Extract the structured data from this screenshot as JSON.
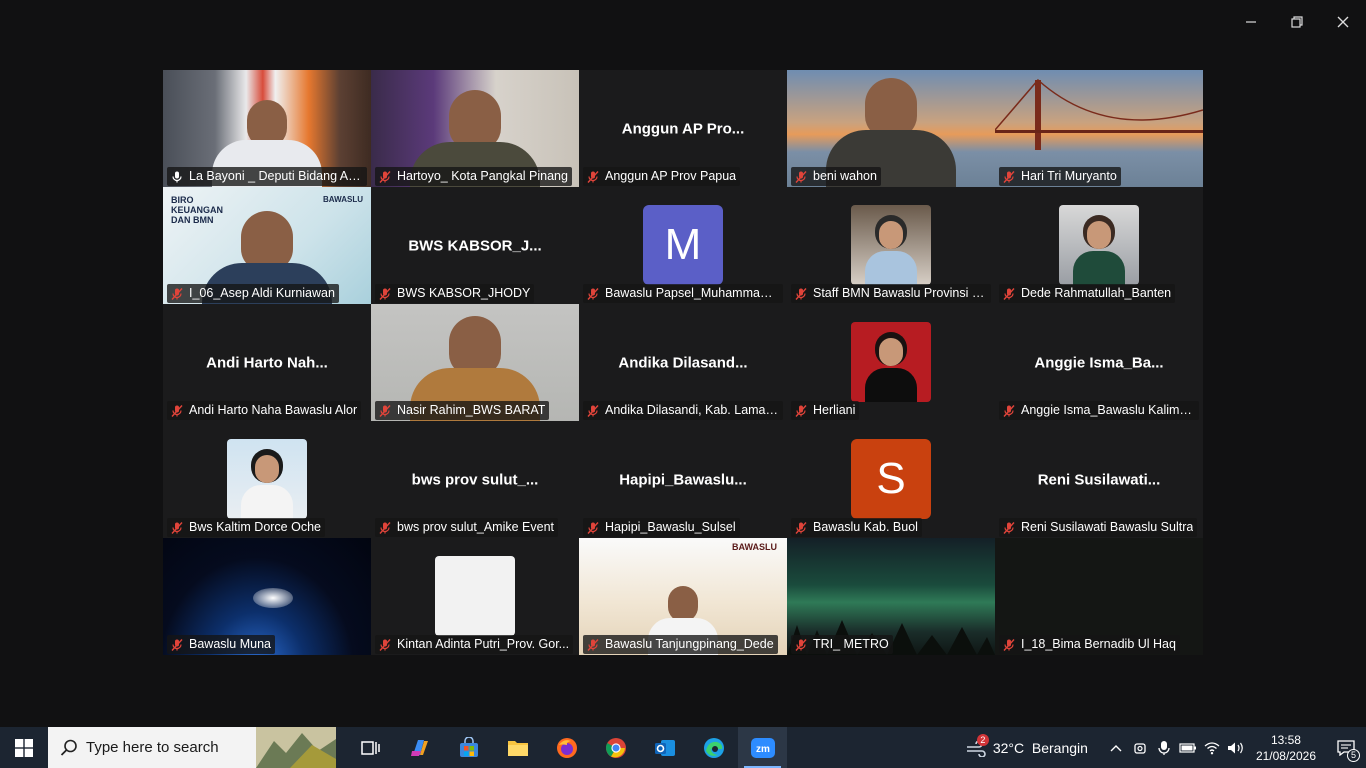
{
  "window_controls": {
    "minimize": "minimize",
    "restore": "restore",
    "close": "close"
  },
  "colors": {
    "active_speaker_border": "#2fd36a",
    "muted_mic": "#e0443a",
    "avatar_m": "#5b5fc7",
    "avatar_s": "#c9410f"
  },
  "participants": [
    {
      "label": "La Bayoni _ Deputi Bidang Ad...",
      "tile_name": "",
      "type": "video",
      "muted": false,
      "active": true
    },
    {
      "label": "Hartoyo_ Kota Pangkal Pinang",
      "tile_name": "",
      "type": "video",
      "muted": true
    },
    {
      "label": "Anggun AP Prov Papua",
      "tile_name": "Anggun AP Pro...",
      "type": "name",
      "muted": true
    },
    {
      "label": "beni wahon",
      "tile_name": "",
      "type": "video",
      "muted": true
    },
    {
      "label": "Hari Tri Muryanto",
      "tile_name": "",
      "type": "video",
      "muted": true
    },
    {
      "label": "I_06_Asep Aldi Kurniawan",
      "tile_name": "",
      "type": "video",
      "muted": true
    },
    {
      "label": "BWS KABSOR_JHODY",
      "tile_name": "BWS KABSOR_J...",
      "type": "name",
      "muted": true
    },
    {
      "label": "Bawaslu Papsel_Muhammad S...",
      "tile_name": "",
      "type": "avatar",
      "initial": "M",
      "muted": true
    },
    {
      "label": "Staff BMN Bawaslu Provinsi P...",
      "tile_name": "",
      "type": "photo",
      "muted": true
    },
    {
      "label": "Dede Rahmatullah_Banten",
      "tile_name": "",
      "type": "photo",
      "muted": true
    },
    {
      "label": "Andi Harto Naha Bawaslu Alor",
      "tile_name": "Andi Harto Nah...",
      "type": "name",
      "muted": true
    },
    {
      "label": "Nasir Rahim_BWS BARAT",
      "tile_name": "",
      "type": "video",
      "muted": true
    },
    {
      "label": "Andika Dilasandi, Kab. Laman...",
      "tile_name": "Andika Dilasand...",
      "type": "name",
      "muted": true
    },
    {
      "label": "Herliani",
      "tile_name": "",
      "type": "photo",
      "muted": true
    },
    {
      "label": "Anggie Isma_Bawaslu Kaliman...",
      "tile_name": "Anggie Isma_Ba...",
      "type": "name",
      "muted": true
    },
    {
      "label": "Bws Kaltim Dorce Oche",
      "tile_name": "",
      "type": "photo",
      "muted": true
    },
    {
      "label": "bws prov sulut_Amike Event",
      "tile_name": "bws prov sulut_...",
      "type": "name",
      "muted": true
    },
    {
      "label": "Hapipi_Bawaslu_Sulsel",
      "tile_name": "Hapipi_Bawaslu...",
      "type": "name",
      "muted": true
    },
    {
      "label": "Bawaslu Kab. Buol",
      "tile_name": "",
      "type": "avatar",
      "initial": "S",
      "muted": true
    },
    {
      "label": "Reni Susilawati Bawaslu Sultra",
      "tile_name": "Reni Susilawati...",
      "type": "name",
      "muted": true
    },
    {
      "label": "Bawaslu Muna",
      "tile_name": "",
      "type": "video",
      "muted": true
    },
    {
      "label": "Kintan Adinta Putri_Prov. Gor...",
      "tile_name": "",
      "type": "photo",
      "muted": true
    },
    {
      "label": "Bawaslu Tanjungpinang_Dede",
      "tile_name": "",
      "type": "video",
      "muted": true
    },
    {
      "label": "TRI_ METRO",
      "tile_name": "",
      "type": "video",
      "muted": true
    },
    {
      "label": "I_18_Bima Bernadib Ul Haq",
      "tile_name": "",
      "type": "video",
      "muted": true
    }
  ],
  "tile_overlays": {
    "biro_text": "BIRO KEUANGAN DAN BMN",
    "bawaslu_logo": "BAWASLU"
  },
  "taskbar": {
    "search_placeholder": "Type here to search",
    "weather_badge": "2",
    "weather": "32°C  Berangin",
    "time": "13:58",
    "date": "21/08/2026",
    "notification_count": "5"
  }
}
